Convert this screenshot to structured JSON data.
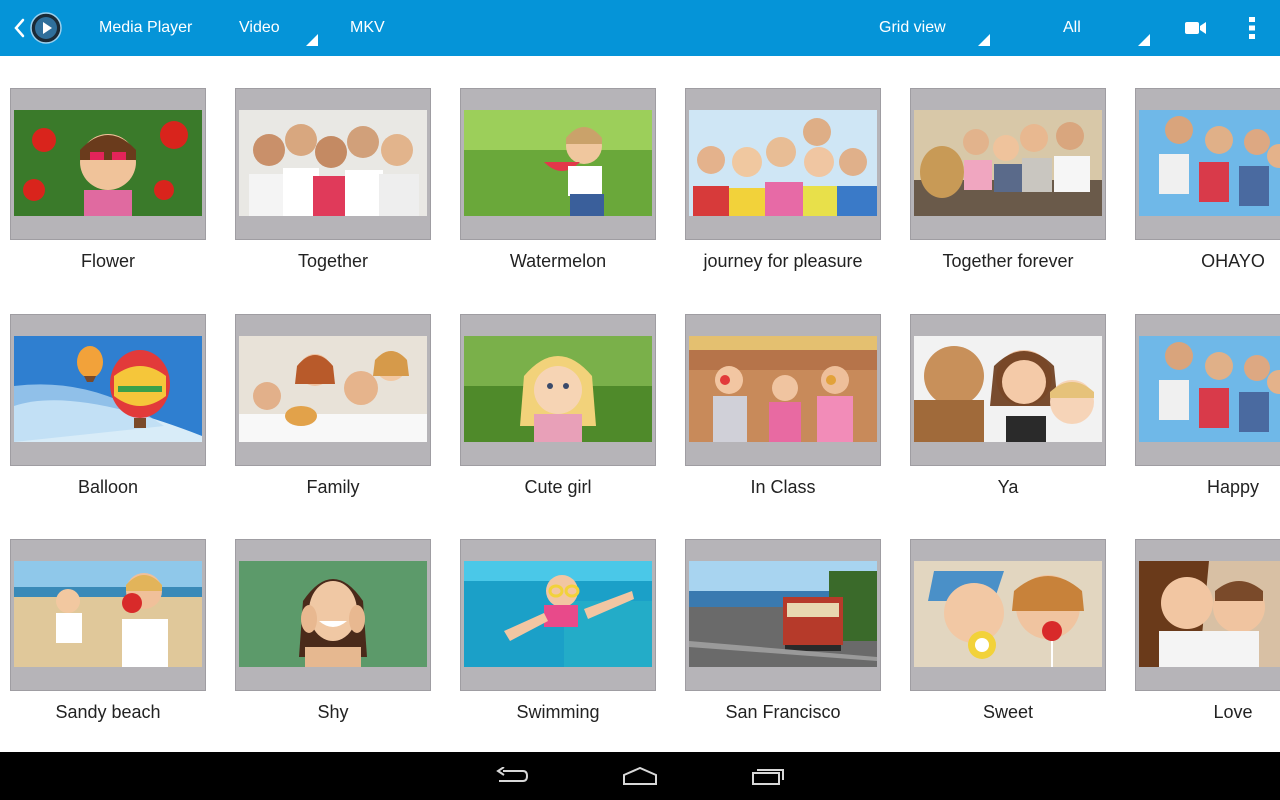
{
  "topbar": {
    "app_title": "Media Player",
    "category": "Video",
    "format": "MKV",
    "view_mode": "Grid view",
    "filter": "All",
    "background_color": "#0594d8"
  },
  "tiles": [
    {
      "label": "Flower"
    },
    {
      "label": "Together"
    },
    {
      "label": "Watermelon"
    },
    {
      "label": "journey for pleasure"
    },
    {
      "label": "Together forever"
    },
    {
      "label": "OHAYO"
    },
    {
      "label": "Balloon"
    },
    {
      "label": "Family"
    },
    {
      "label": "Cute girl"
    },
    {
      "label": "In Class"
    },
    {
      "label": "Ya"
    },
    {
      "label": "Happy"
    },
    {
      "label": "Sandy beach"
    },
    {
      "label": "Shy"
    },
    {
      "label": "Swimming"
    },
    {
      "label": "San Francisco"
    },
    {
      "label": "Sweet"
    },
    {
      "label": "Love"
    }
  ],
  "icons": {
    "back": "chevron-left-icon",
    "app": "play-circle-icon",
    "camera": "video-camera-icon",
    "overflow": "more-vertical-icon",
    "nav_back": "back-arrow-icon",
    "nav_home": "home-icon",
    "nav_recents": "recent-apps-icon"
  }
}
